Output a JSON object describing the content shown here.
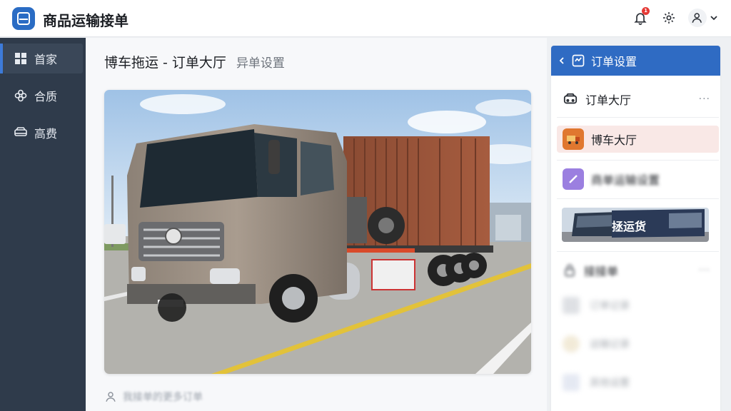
{
  "app": {
    "title": "商品运输接单"
  },
  "topbar": {
    "notification_count": "1",
    "icons": [
      "bell-icon",
      "gear-icon",
      "user-icon",
      "chevron-down-icon"
    ]
  },
  "sidebar": {
    "items": [
      {
        "label": "首家",
        "icon": "grid-icon",
        "active": true
      },
      {
        "label": "合质",
        "icon": "flower-icon",
        "active": false
      },
      {
        "label": "高费",
        "icon": "car-icon",
        "active": false
      }
    ]
  },
  "main": {
    "title": "博车拖运 - 订单大厅",
    "subtitle": "异单设置",
    "footer_text": "我接单的更多订单"
  },
  "right_panel": {
    "header": "订单设置",
    "section1": {
      "label": "订单大厅",
      "more": "···"
    },
    "highlight": {
      "label": "博车大厅"
    },
    "blurred_item": {
      "label": "商单运输设置"
    },
    "banner_text": "拯运货",
    "section2": {
      "label": "接接单",
      "more": "···"
    },
    "ghost_items": [
      "订单记录",
      "运输记录",
      "其他设置"
    ]
  },
  "colors": {
    "accent": "#2f6bc3",
    "sidebar_bg": "#2f3b4b",
    "highlight_bg": "#f9e8e6",
    "badge": "#e53935"
  }
}
